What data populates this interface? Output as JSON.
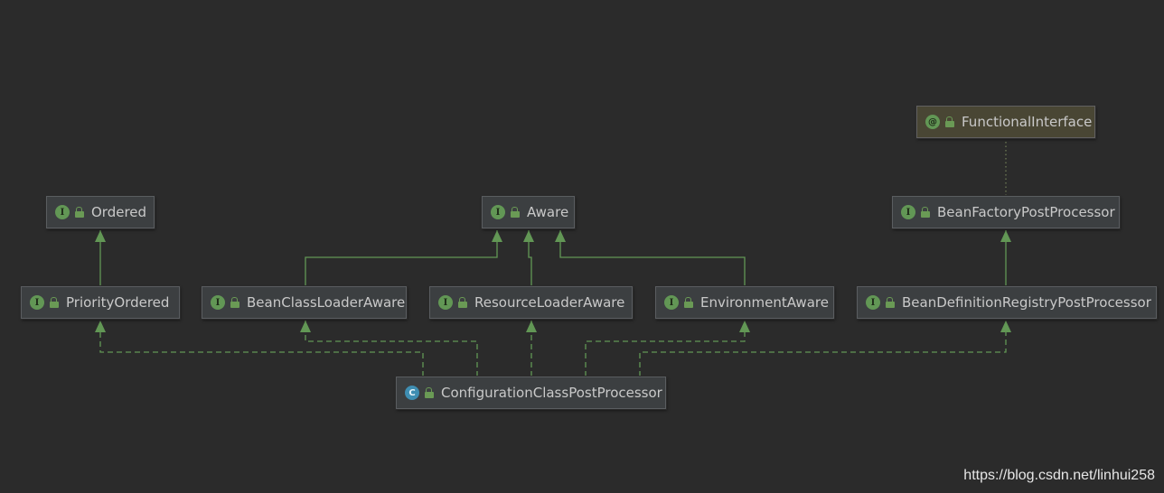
{
  "diagram": {
    "nodes": [
      {
        "id": "functional-interface",
        "kind": "annotation",
        "badge": "@",
        "label": "FunctionalInterface"
      },
      {
        "id": "ordered",
        "kind": "interface",
        "badge": "I",
        "label": "Ordered"
      },
      {
        "id": "aware",
        "kind": "interface",
        "badge": "I",
        "label": "Aware"
      },
      {
        "id": "bean-factory-post-processor",
        "kind": "interface",
        "badge": "I",
        "label": "BeanFactoryPostProcessor"
      },
      {
        "id": "priority-ordered",
        "kind": "interface",
        "badge": "I",
        "label": "PriorityOrdered"
      },
      {
        "id": "bean-class-loader-aware",
        "kind": "interface",
        "badge": "I",
        "label": "BeanClassLoaderAware"
      },
      {
        "id": "resource-loader-aware",
        "kind": "interface",
        "badge": "I",
        "label": "ResourceLoaderAware"
      },
      {
        "id": "environment-aware",
        "kind": "interface",
        "badge": "I",
        "label": "EnvironmentAware"
      },
      {
        "id": "bean-definition-registry-post-processor",
        "kind": "interface",
        "badge": "I",
        "label": "BeanDefinitionRegistryPostProcessor"
      },
      {
        "id": "configuration-class-post-processor",
        "kind": "class",
        "badge": "C",
        "label": "ConfigurationClassPostProcessor"
      }
    ],
    "edges": [
      {
        "from": "priority-ordered",
        "to": "ordered",
        "type": "extends"
      },
      {
        "from": "bean-class-loader-aware",
        "to": "aware",
        "type": "extends"
      },
      {
        "from": "resource-loader-aware",
        "to": "aware",
        "type": "extends"
      },
      {
        "from": "environment-aware",
        "to": "aware",
        "type": "extends"
      },
      {
        "from": "bean-definition-registry-post-processor",
        "to": "bean-factory-post-processor",
        "type": "extends"
      },
      {
        "from": "bean-factory-post-processor",
        "to": "functional-interface",
        "type": "annotated"
      },
      {
        "from": "configuration-class-post-processor",
        "to": "priority-ordered",
        "type": "implements"
      },
      {
        "from": "configuration-class-post-processor",
        "to": "bean-class-loader-aware",
        "type": "implements"
      },
      {
        "from": "configuration-class-post-processor",
        "to": "resource-loader-aware",
        "type": "implements"
      },
      {
        "from": "configuration-class-post-processor",
        "to": "environment-aware",
        "type": "implements"
      },
      {
        "from": "configuration-class-post-processor",
        "to": "bean-definition-registry-post-processor",
        "type": "implements"
      }
    ]
  },
  "colors": {
    "background": "#2b2b2b",
    "edge": "#629755",
    "interface_badge": "#629755",
    "class_badge": "#3f8eb2",
    "annotation_box": "#494634"
  },
  "watermark": "https://blog.csdn.net/linhui258"
}
